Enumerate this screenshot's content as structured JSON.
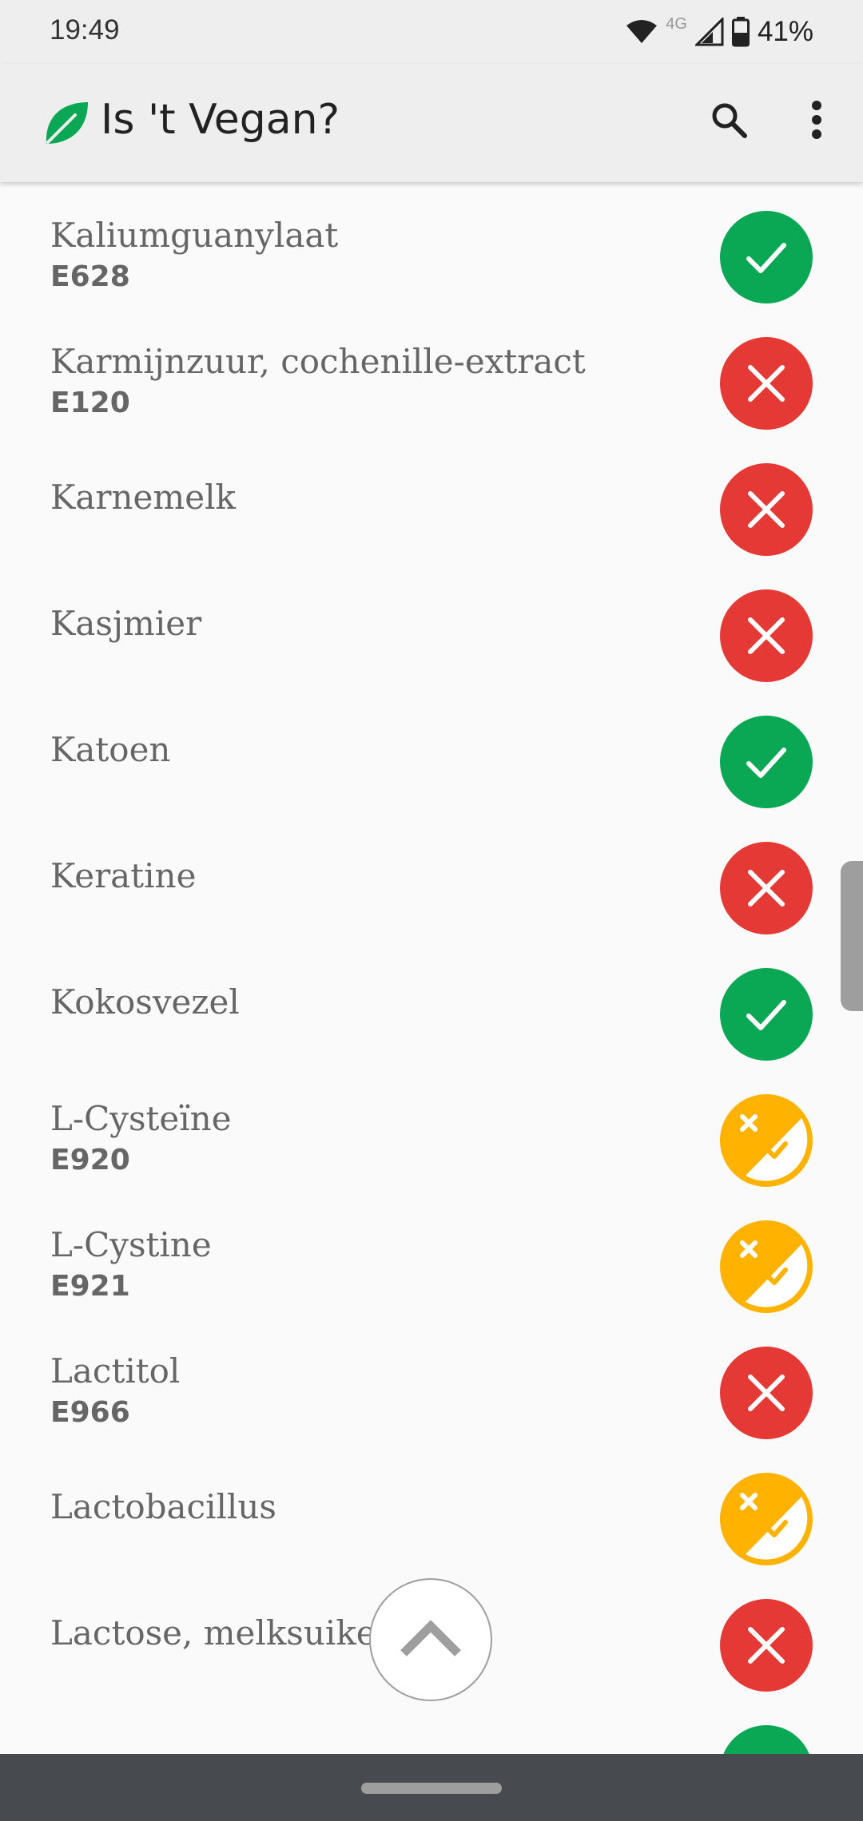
{
  "status_bar": {
    "time": "19:49",
    "network": "4G",
    "battery": "41%"
  },
  "app_bar": {
    "title": "Is 't Vegan?",
    "logo_icon": "leaf-icon",
    "actions": [
      "search-icon",
      "more-vert-icon"
    ]
  },
  "colors": {
    "vegan": "#0aa755",
    "not_vegan": "#e53935",
    "maybe": "#ffb300"
  },
  "items": [
    {
      "name": "Kaliumguanylaat",
      "code": "E628",
      "status": "vegan"
    },
    {
      "name": "Karmijnzuur, cochenille-extract",
      "code": "E120",
      "status": "not-vegan"
    },
    {
      "name": "Karnemelk",
      "code": "",
      "status": "not-vegan"
    },
    {
      "name": "Kasjmier",
      "code": "",
      "status": "not-vegan"
    },
    {
      "name": "Katoen",
      "code": "",
      "status": "vegan"
    },
    {
      "name": "Keratine",
      "code": "",
      "status": "not-vegan"
    },
    {
      "name": "Kokosvezel",
      "code": "",
      "status": "vegan"
    },
    {
      "name": "L-Cysteïne",
      "code": "E920",
      "status": "maybe"
    },
    {
      "name": "L-Cystine",
      "code": "E921",
      "status": "maybe"
    },
    {
      "name": "Lactitol",
      "code": "E966",
      "status": "not-vegan"
    },
    {
      "name": "Lactobacillus",
      "code": "",
      "status": "maybe"
    },
    {
      "name": "Lactose, melksuiker",
      "code": "",
      "status": "not-vegan"
    },
    {
      "name": "",
      "code": "",
      "status": "vegan"
    }
  ],
  "scroll_top_icon": "chevron-up-icon"
}
